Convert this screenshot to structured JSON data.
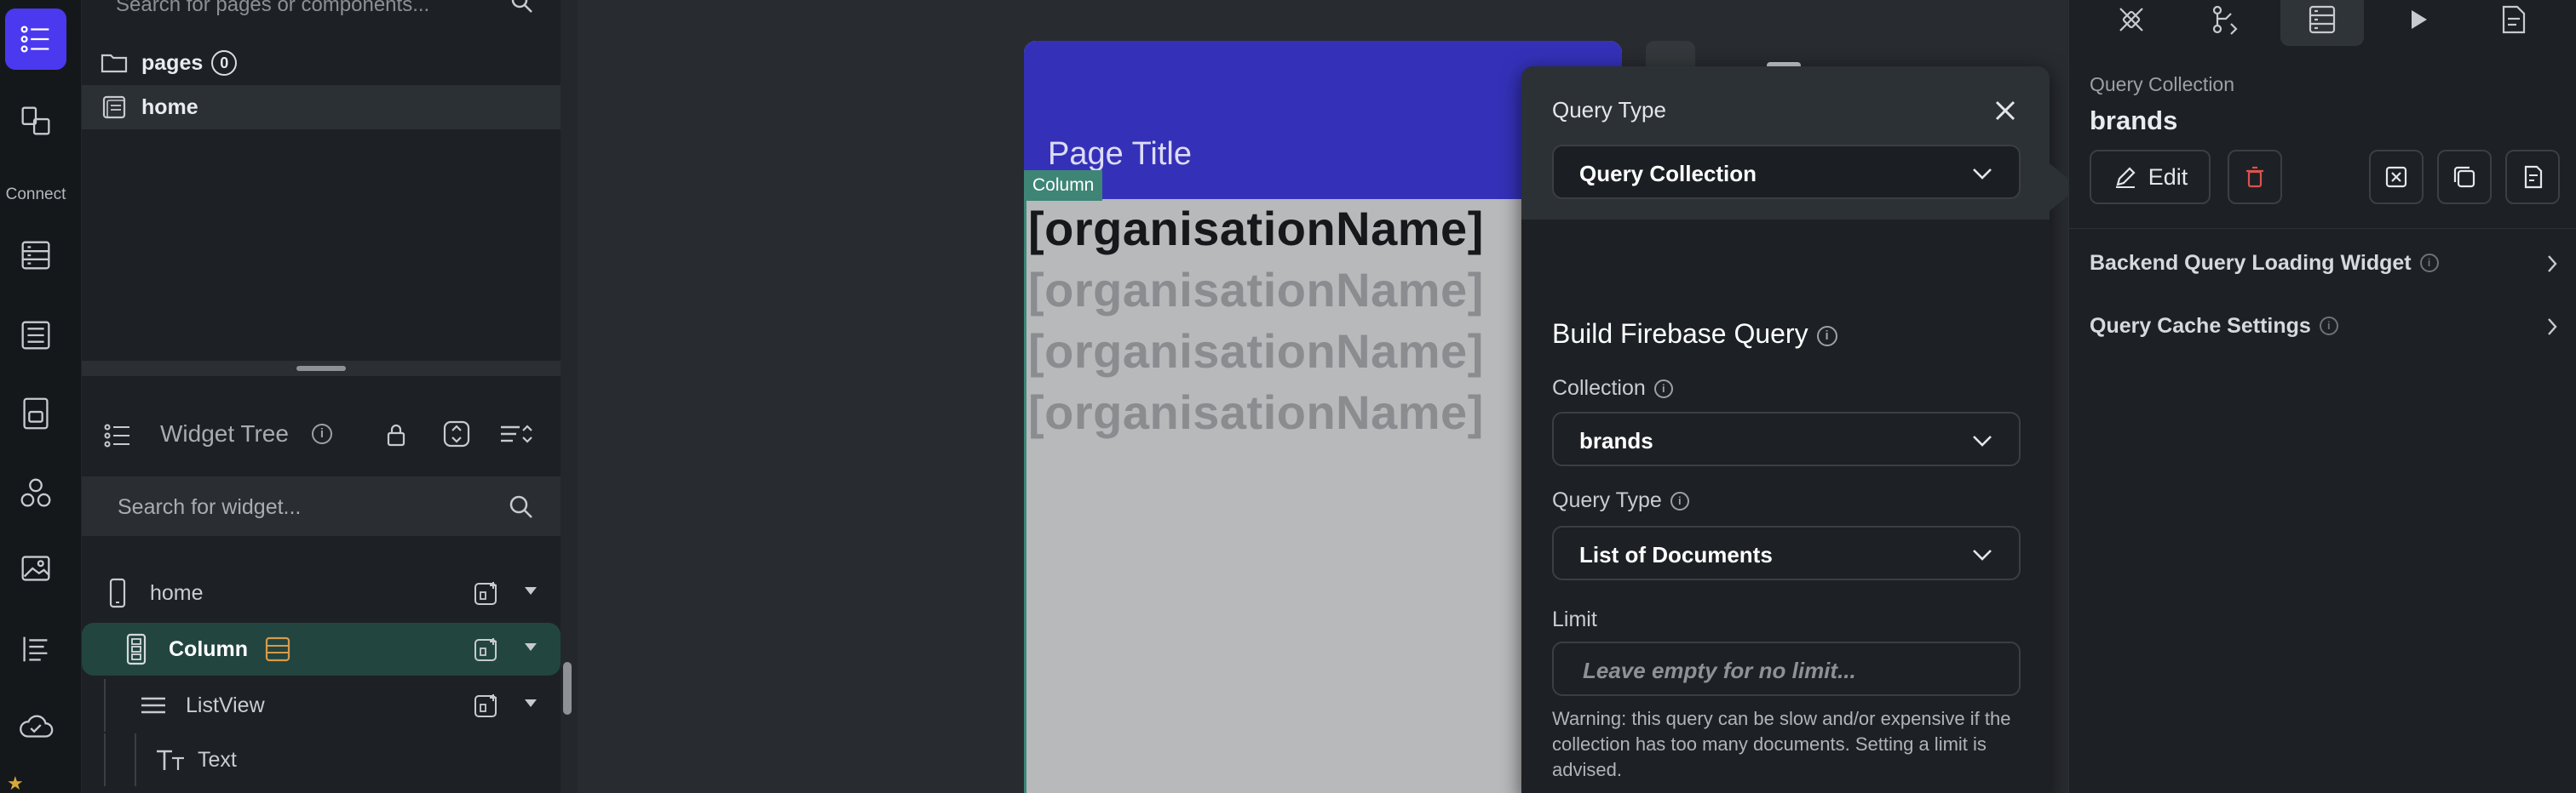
{
  "rail": {
    "connect_label": "Connect"
  },
  "pages_panel": {
    "search_placeholder": "Search for pages or components...",
    "pages_label": "pages",
    "pages_count": "0",
    "home_label": "home"
  },
  "widget_tree": {
    "title": "Widget Tree",
    "search_placeholder": "Search for widget...",
    "items": [
      {
        "label": "home"
      },
      {
        "label": "Column"
      },
      {
        "label": "ListView"
      },
      {
        "label": "Text"
      }
    ]
  },
  "canvas": {
    "page_title": "Page Title",
    "column_tag": "Column",
    "org_items": [
      "[organisationName]",
      "[organisationName]",
      "[organisationName]",
      "[organisationName]"
    ]
  },
  "query_popup": {
    "query_type_label": "Query Type",
    "query_type_value": "Query Collection",
    "section_title": "Build Firebase Query",
    "collection_label": "Collection",
    "collection_value": "brands",
    "inner_query_type_label": "Query Type",
    "inner_query_type_value": "List of Documents",
    "limit_label": "Limit",
    "limit_placeholder": "Leave empty for no limit...",
    "warning": "Warning: this query can be slow and/or expensive if the collection has too many documents. Setting a limit is advised."
  },
  "right_panel": {
    "subtitle": "Query Collection",
    "title": "brands",
    "edit_label": "Edit",
    "rows": [
      {
        "label": "Backend Query Loading Widget"
      },
      {
        "label": "Query Cache Settings"
      }
    ]
  },
  "colors": {
    "accent": "#4b39ef",
    "appbar": "#3431b8",
    "selection": "#224540",
    "column_outline": "#3e8576",
    "delete": "#d9534f"
  },
  "icons": [
    "list-icon",
    "components-icon",
    "database-icon",
    "tree-icon",
    "storage-icon",
    "integrations-icon",
    "media-icon",
    "text-icon",
    "cloud-icon",
    "folder-icon",
    "page-icon",
    "search-icon",
    "info-icon",
    "lock-icon",
    "expand-icon",
    "sort-icon",
    "phone-icon",
    "column-icon",
    "listview-icon",
    "text-widget-icon",
    "close-icon",
    "chevron-down-icon",
    "edit-icon",
    "trash-icon",
    "chevron-right-icon",
    "play-icon"
  ]
}
